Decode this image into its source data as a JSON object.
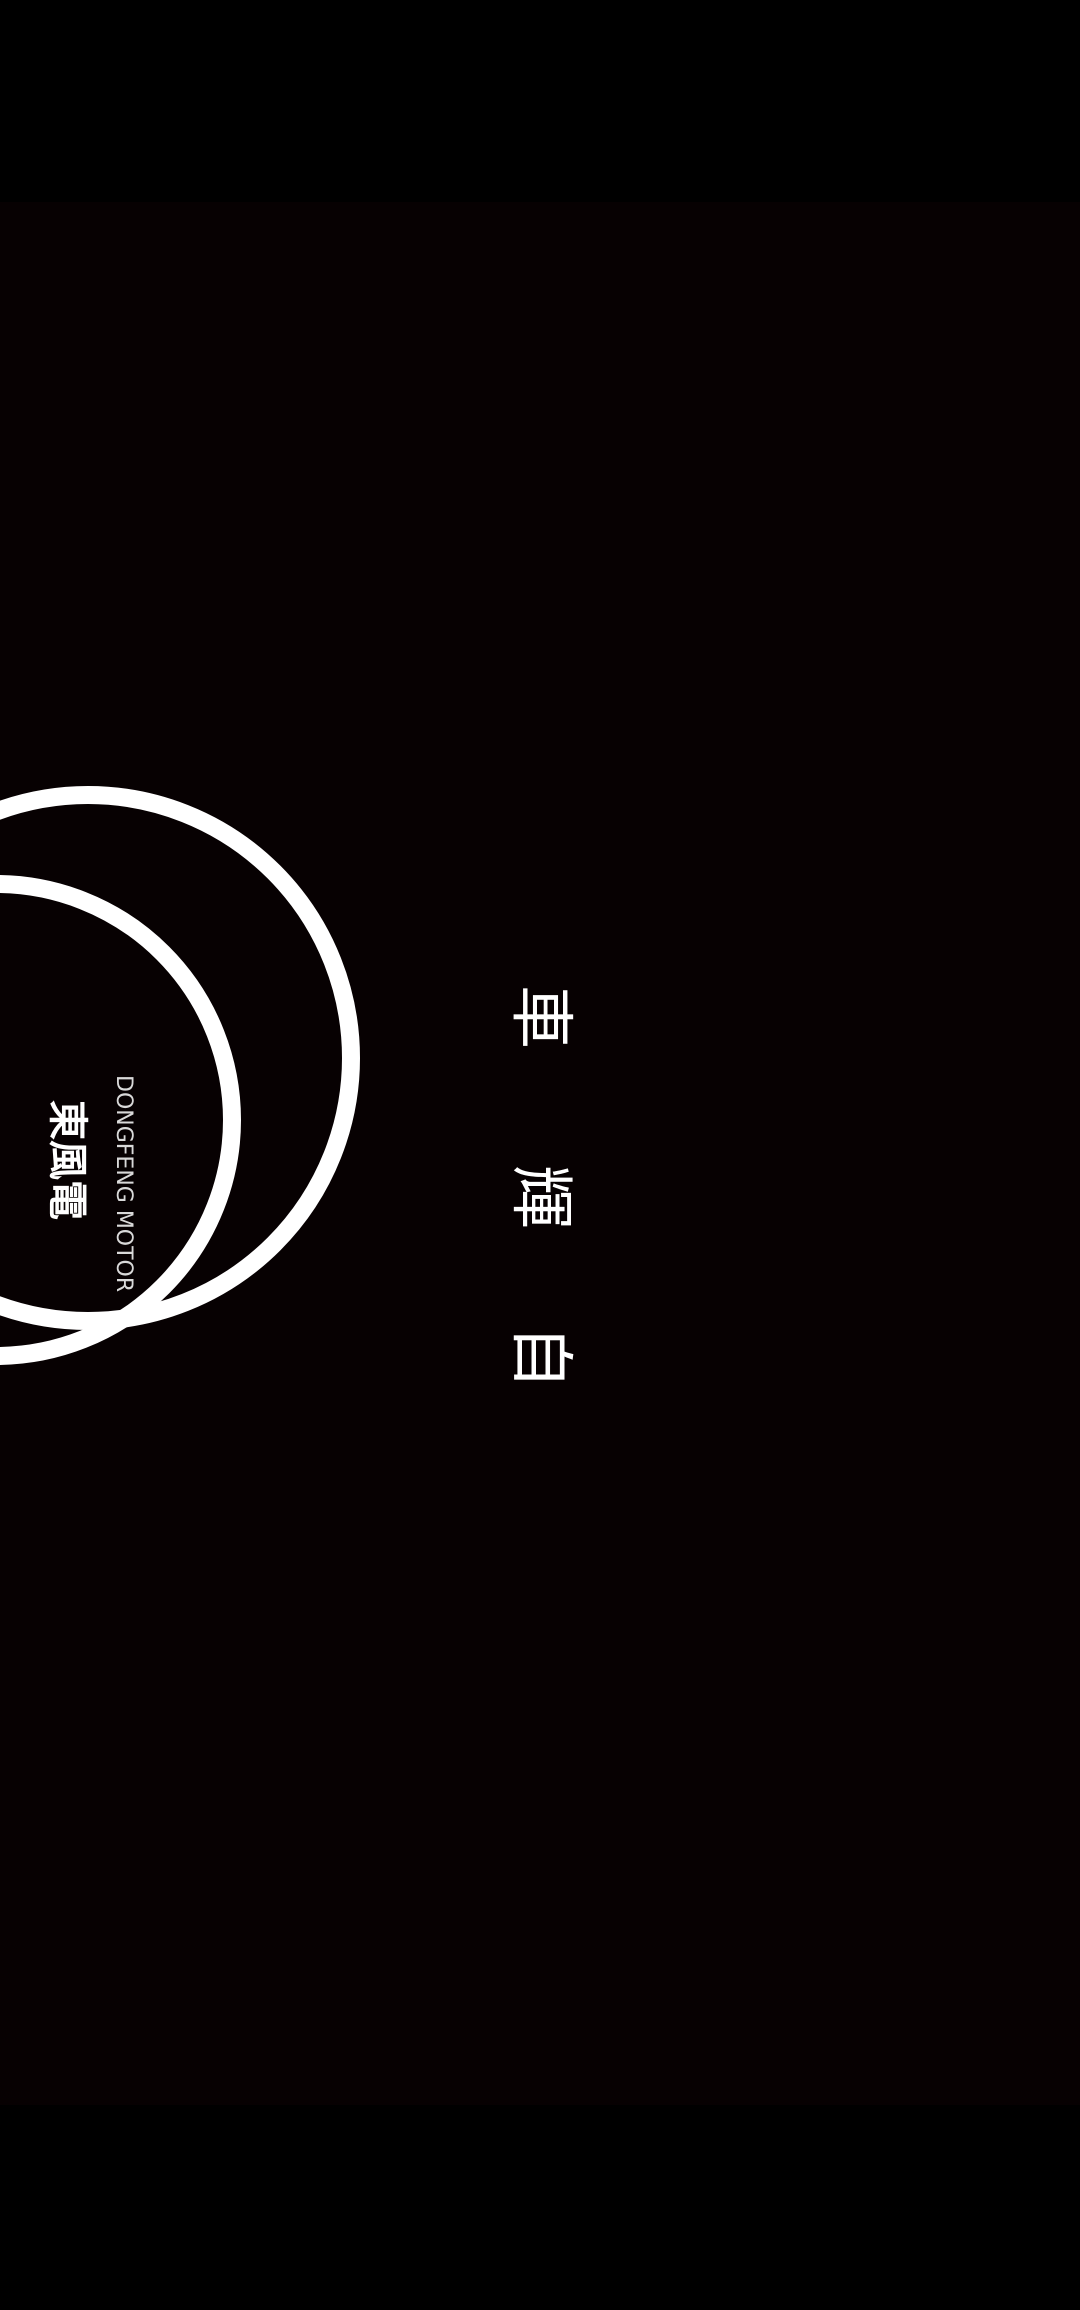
{
  "screen": {
    "background_color": "#070102",
    "letterbox_color": "#000000",
    "ring_color": "#ffffff",
    "text_color": "#ffffff"
  },
  "video": {
    "title_glyphs": [
      "車",
      "輝",
      "自"
    ],
    "logo": {
      "main_text": "東風電",
      "sub_text": "DONGFENG MOTOR"
    }
  }
}
